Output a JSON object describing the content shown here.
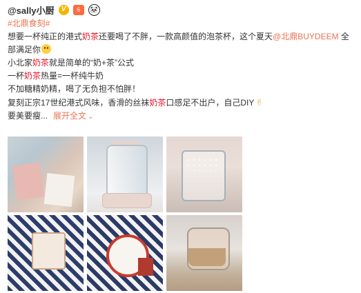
{
  "post": {
    "username": "@sally小厨",
    "badges": {
      "verified": "V",
      "level": "6",
      "panda": "🐼"
    },
    "topic": "#北鼎食刻#",
    "line1": {
      "a": "想要一杯纯正的港式",
      "hl": "奶茶",
      "b": "还要喝了不胖，一款高颜值的泡茶杯，这个夏天",
      "link": "@北鼎BUYDEEM",
      "c": " 全"
    },
    "line2": "部满足你",
    "line3": {
      "a": "小北家",
      "hl": "奶茶",
      "b": "就是简单的“奶+茶”公式"
    },
    "line4": {
      "a": "一杯",
      "hl": "奶茶",
      "b": "热量=一杯纯牛奶"
    },
    "line5": "不加糖精奶精，喝了无负担不怕胖！",
    "line6": {
      "a": "复刻正宗17世纪港式风味，香滑的丝袜",
      "hl": "奶茶",
      "b": "口感足不出户，自己DIY"
    },
    "line7": {
      "a": "要美要瘦",
      "dots": "...",
      "expand": "展开全文",
      "chevron": "⌄"
    },
    "colors": {
      "accent": "#eb7350",
      "highlight": "#e6162d",
      "text": "#333333"
    }
  },
  "photos": [
    {
      "icon": "tea-packages-photo"
    },
    {
      "icon": "glass-kettle-photo"
    },
    {
      "icon": "kettle-lid-photo"
    },
    {
      "icon": "tea-infuser-photo"
    },
    {
      "icon": "timer-and-cup-photo"
    },
    {
      "icon": "milk-tea-pot-photo"
    }
  ]
}
